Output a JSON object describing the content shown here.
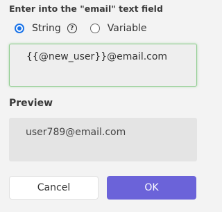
{
  "form": {
    "title": "Enter into the \"email\" text field",
    "options": {
      "string_label": "String",
      "variable_label": "Variable",
      "selected": "String",
      "help_glyph": "?"
    },
    "field_value": "{{@new_user}}@email.com",
    "preview_title": "Preview",
    "preview_value": "user789@email.com"
  },
  "buttons": {
    "cancel_label": "Cancel",
    "ok_label": "OK"
  },
  "colors": {
    "accent": "#6b63d9",
    "radio_selected": "#1a73e8",
    "field_focus_border": "#8fcc8f"
  }
}
